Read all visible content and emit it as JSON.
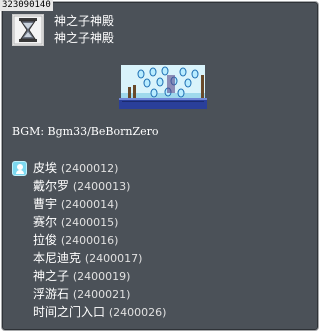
{
  "map_id": "323090140",
  "street_name": "神之子神殿",
  "map_name": "神之子神殿",
  "icon": "hourglass-icon",
  "minimap_image": "temple-minimap-image",
  "bgm": "BGM: Bgm33/BeBornZero",
  "npc_marker_icon": "npc-marker-icon",
  "npcs": [
    {
      "name": "皮埃",
      "id": "(2400012)"
    },
    {
      "name": "戴尔罗",
      "id": "(2400013)"
    },
    {
      "name": "曹宇",
      "id": "(2400014)"
    },
    {
      "name": "赛尔",
      "id": "(2400015)"
    },
    {
      "name": "拉俊",
      "id": "(2400016)"
    },
    {
      "name": "本尼迪克",
      "id": "(2400017)"
    },
    {
      "name": "神之子",
      "id": "(2400019)"
    },
    {
      "name": "浮游石",
      "id": "(2400021)"
    },
    {
      "name": "时间之门入口",
      "id": "(2400026)"
    }
  ],
  "colors": {
    "background": "#4b5158",
    "border": "#a7a9ab",
    "text": "#ffffff",
    "marker": "#7dd9f0"
  }
}
